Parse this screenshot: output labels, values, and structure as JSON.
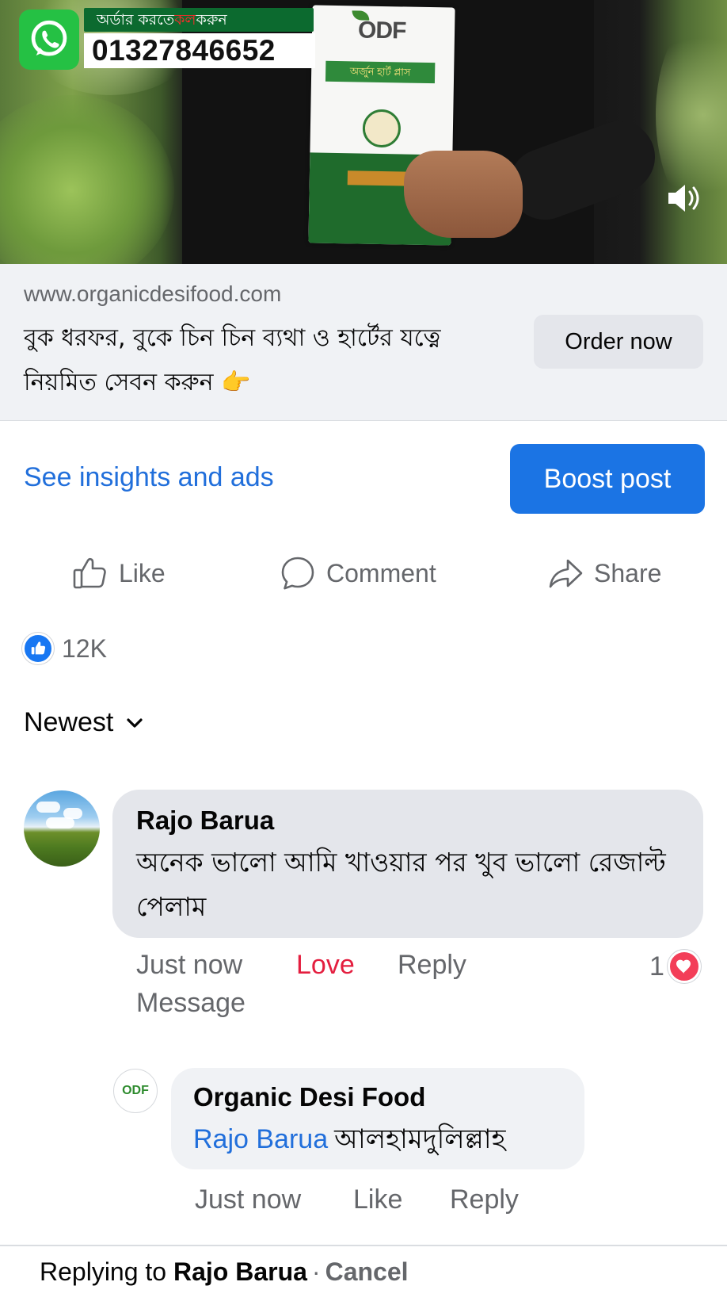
{
  "video": {
    "order_badge_prefix": "অর্ডার করতে",
    "order_badge_highlight": "কল",
    "order_badge_suffix": "করুন",
    "phone_number": "01327846652",
    "product_brand": "ODF",
    "product_name": "অর্জুন হার্ট প্লাস"
  },
  "link_preview": {
    "domain": "www.organicdesifood.com",
    "headline": "বুক ধরফর, বুকে চিন চিন ব্যথা ও হার্টের যত্নে নিয়মিত সেবন করুন 👉",
    "cta_label": "Order now"
  },
  "insights": {
    "link_label": "See insights and ads",
    "boost_label": "Boost post"
  },
  "actions": {
    "like": "Like",
    "comment": "Comment",
    "share": "Share"
  },
  "reactions": {
    "count": "12K"
  },
  "sort": {
    "label": "Newest"
  },
  "comments": [
    {
      "author": "Rajo Barua",
      "text": "অনেক ভালো আমি খাওয়ার পর খুব ভালো রেজাল্ট পেলাম",
      "time": "Just now",
      "reaction_label": "Love",
      "reply_label": "Reply",
      "message_label": "Message",
      "reaction_count": "1"
    },
    {
      "author": "Organic Desi Food",
      "mention": "Rajo Barua",
      "text": "আলহামদুলিল্লাহ",
      "time": "Just now",
      "like_label": "Like",
      "reply_label": "Reply",
      "avatar_text": "ODF"
    }
  ],
  "reply_bar": {
    "prefix": "Replying to",
    "name": "Rajo Barua",
    "separator": "·",
    "cancel": "Cancel"
  },
  "colors": {
    "accent_blue": "#1b74e4",
    "link_blue": "#216fdb",
    "love_red": "#e41e3f",
    "whatsapp_green": "#25c144"
  }
}
